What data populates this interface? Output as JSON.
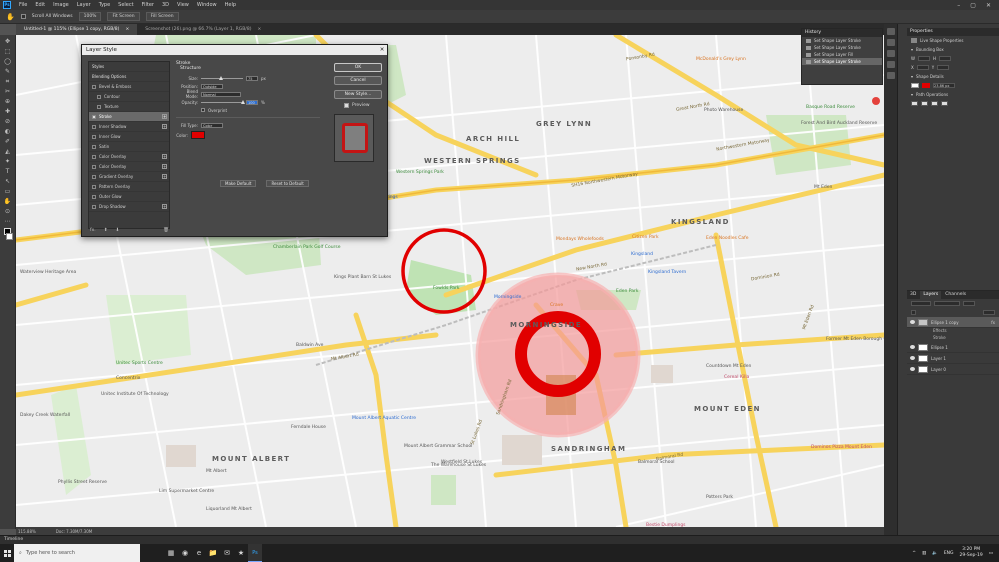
{
  "menubar": {
    "logo": "Ps",
    "items": [
      "File",
      "Edit",
      "Image",
      "Layer",
      "Type",
      "Select",
      "Filter",
      "3D",
      "View",
      "Window",
      "Help"
    ],
    "window_controls": [
      "–",
      "▢",
      "✕"
    ]
  },
  "options_bar": {
    "scroll_all_label": "Scroll All Windows",
    "zoom_value": "100%",
    "fit_screen": "Fit Screen",
    "fill_screen": "Fill Screen"
  },
  "tabs": [
    {
      "label": "Untitled-1 @ 115% (Ellipse 1 copy, RGB/8)",
      "active": true
    },
    {
      "label": "Screenshot (26).png @ 66.7% (Layer 1, RGB/8)",
      "active": false
    }
  ],
  "tools": [
    "✥",
    "⬚",
    "◯",
    "✎",
    "⌗",
    "✂",
    "⊕",
    "✚",
    "⊘",
    "◐",
    "✐",
    "◭",
    "✦",
    "T",
    "↖",
    "▭",
    "✋",
    "⊙",
    "⋯"
  ],
  "status_bar": {
    "zoom": "115.88%",
    "doc": "Doc: 7.30M/7.30M"
  },
  "timeline": {
    "label": "Timeline"
  },
  "history": {
    "title": "History",
    "items": [
      {
        "label": "Set Shape Layer Stroke",
        "selected": false
      },
      {
        "label": "Set Shape Layer Stroke",
        "selected": false
      },
      {
        "label": "Set Shape Layer Fill",
        "selected": false
      },
      {
        "label": "Set Shape Layer Stroke",
        "selected": true
      }
    ]
  },
  "properties": {
    "title": "Properties",
    "subtitle": "Live Shape Properties",
    "bounding_box": "Bounding Box",
    "w_label": "W",
    "h_label": "H",
    "x_label": "X",
    "y_label": "Y",
    "shape_details": "Shape Details",
    "stroke_size": "23.86 px",
    "pathfinder": "Path Operations"
  },
  "layers": {
    "tabs": [
      "3D",
      "Layers",
      "Channels"
    ],
    "active_tab": "Layers",
    "rows": [
      {
        "name": "Ellipse 1 copy",
        "selected": true,
        "fx": "fx"
      },
      {
        "name": "Effects",
        "sub": true
      },
      {
        "name": "Stroke",
        "sub": true
      },
      {
        "name": "Ellipse 1",
        "selected": false
      },
      {
        "name": "Layer 1",
        "selected": false
      },
      {
        "name": "Layer 0",
        "selected": false
      }
    ]
  },
  "layer_style": {
    "title": "Layer Style",
    "styles_header": "Styles",
    "blending_options": "Blending Options",
    "items": [
      {
        "label": "Bevel & Emboss",
        "checked": false,
        "plus": false
      },
      {
        "label": "Contour",
        "checked": false,
        "plus": false,
        "indent": true
      },
      {
        "label": "Texture",
        "checked": false,
        "plus": false,
        "indent": true
      },
      {
        "label": "Stroke",
        "checked": true,
        "plus": true,
        "selected": true
      },
      {
        "label": "Inner Shadow",
        "checked": false,
        "plus": true
      },
      {
        "label": "Inner Glow",
        "checked": false,
        "plus": false
      },
      {
        "label": "Satin",
        "checked": false,
        "plus": false
      },
      {
        "label": "Color Overlay",
        "checked": false,
        "plus": true
      },
      {
        "label": "Color Overlay",
        "checked": false,
        "plus": true
      },
      {
        "label": "Gradient Overlay",
        "checked": false,
        "plus": true
      },
      {
        "label": "Pattern Overlay",
        "checked": false,
        "plus": false
      },
      {
        "label": "Outer Glow",
        "checked": false,
        "plus": false
      },
      {
        "label": "Drop Shadow",
        "checked": false,
        "plus": true
      }
    ],
    "footer_fx": "fx.",
    "stroke_title": "Stroke",
    "structure_title": "Structure",
    "size_label": "Size:",
    "size_value": "75",
    "size_unit": "px",
    "position_label": "Position:",
    "position_value": "Outside",
    "blend_label": "Blend Mode:",
    "blend_value": "Normal",
    "opacity_label": "Opacity:",
    "opacity_value": "100",
    "opacity_unit": "%",
    "overprint_label": "Overprint",
    "fill_type_label": "Fill Type:",
    "fill_type_value": "Color",
    "color_label": "Color:",
    "stroke_color": "#e10000",
    "make_default": "Make Default",
    "reset_default": "Reset to Default",
    "ok": "OK",
    "cancel": "Cancel",
    "new_style": "New Style...",
    "preview": "Preview"
  },
  "map": {
    "districts": [
      "ARCH HILL",
      "GREY LYNN",
      "WESTERN SPRINGS",
      "KINGSLAND",
      "MORNINGSIDE",
      "MOUNT EDEN",
      "MOUNT ALBERT",
      "SANDRINGHAM"
    ],
    "roads": [
      "SH16 Northwestern Motorway",
      "Northwestern Motorway",
      "Great North Rd",
      "New North Rd",
      "Sandringham Rd",
      "St Lukes Rd",
      "Mt Albert Rd",
      "Dominion Rd",
      "Balmoral Rd",
      "Mt Eden Rd",
      "Carrington Rd",
      "Woodward Rd",
      "Richmond Rd",
      "Ponsonby Rd"
    ],
    "parks": [
      "Western Springs Park",
      "Fowlds Park",
      "Chamberlain Park Golf Course",
      "Eden Park",
      "Unitec Sports Centre"
    ],
    "pois": [
      "Western Springs",
      "Kings Plant Barn St Lukes",
      "Morningside",
      "Kingsland",
      "Crave",
      "Mondays Wholefoods",
      "Citizen Park",
      "Eden Noodles Cafe",
      "McDonald's Grey Lynn",
      "Photo Warehouse",
      "Mt Eden",
      "Baldwin Ave",
      "Unitec Institute Of Technology",
      "Mount Albert Aquatic Centre",
      "Mount Albert Grammar School",
      "Westfield St Lukes",
      "The Warehouse St Lukes",
      "Balmoral School",
      "Countdown Mt Eden",
      "Cereal Killa",
      "Mt Albert",
      "Lim Supermarket Centre",
      "Liquorland Mt Albert",
      "Concentrix",
      "Potters Park",
      "Former Mt Eden Borough Council",
      "Dominos Pizza Mount Eden",
      "Bestie Dumplings",
      "Ferndale House",
      "Dakey Creek Waterfall",
      "Waterview Heritage Area",
      "Phyllis Street Reserve",
      "Basque Road Reserve",
      "Forest And Bird Auckland Reserve",
      "Kingsland Tavern"
    ],
    "food_icons": [
      "Mondays Wholefoods",
      "Crave",
      "Eden Noodles Cafe",
      "Cereal Killa"
    ],
    "location_pin_color": "#e4423c"
  },
  "taskbar": {
    "search_placeholder": "Type here to search",
    "lang": "ENG",
    "time": "3:20 PM",
    "date": "29-Sep-19",
    "apps": [
      "▦",
      "◉",
      "e",
      "📁",
      "✉",
      "★",
      "Ps"
    ]
  }
}
